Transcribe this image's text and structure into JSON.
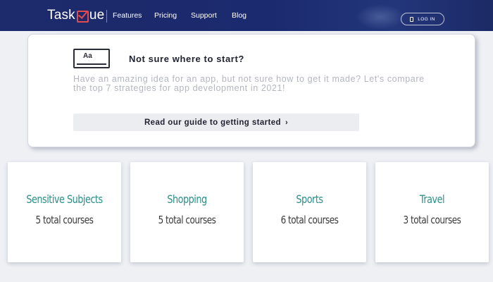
{
  "nav": {
    "logo_task": "Task",
    "logo_ue": "ue",
    "links": [
      "Features",
      "Pricing",
      "Support",
      "Blog"
    ],
    "login_label": "LOG IN"
  },
  "guide": {
    "icon_label": "Aa",
    "title": "Not sure where to start?",
    "description": "Have an amazing idea for an app, but not sure how to get it made? Let's compare the top 7 strategies for app development in 2021!",
    "button_label": "Read our guide to getting started",
    "button_arrow": "›"
  },
  "categories": [
    {
      "name": "Sensitive Subjects",
      "count": "5 total courses"
    },
    {
      "name": "Shopping",
      "count": "5 total courses"
    },
    {
      "name": "Sports",
      "count": "6 total courses"
    },
    {
      "name": "Travel",
      "count": "3 total courses"
    }
  ],
  "colors": {
    "nav_bg": "#1d2a6b",
    "logo_accent": "#e24c50",
    "category_name": "#2a8f87"
  }
}
